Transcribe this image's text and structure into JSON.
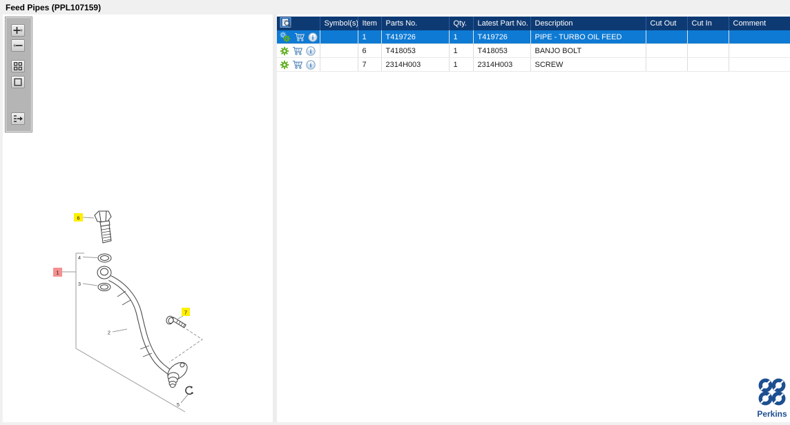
{
  "page": {
    "title": "Feed Pipes (PPL107159)"
  },
  "toolbar": {
    "buttons": [
      {
        "name": "zoom-in"
      },
      {
        "name": "zoom-out"
      },
      {
        "name": "fit-all"
      },
      {
        "name": "full-view"
      },
      {
        "name": "toggle-panel"
      }
    ]
  },
  "diagram": {
    "callouts": [
      {
        "label": "6",
        "highlight": "yellow"
      },
      {
        "label": "4",
        "highlight": "none"
      },
      {
        "label": "1",
        "highlight": "red"
      },
      {
        "label": "3",
        "highlight": "none"
      },
      {
        "label": "2",
        "highlight": "none"
      },
      {
        "label": "7",
        "highlight": "yellow"
      },
      {
        "label": "5",
        "highlight": "none"
      }
    ],
    "highlight_colors": {
      "yellow": "#ffef00",
      "red": "#f49090"
    }
  },
  "table": {
    "columns": [
      "",
      "Symbol(s)",
      "Item",
      "Parts No.",
      "Qty.",
      "Latest Part No.",
      "Description",
      "Cut Out",
      "Cut In",
      "Comment"
    ],
    "rows": [
      {
        "symbols": "",
        "item": "1",
        "parts_no": "T419726",
        "qty": "1",
        "latest_part_no": "T419726",
        "description": "PIPE - TURBO OIL FEED",
        "cut_out": "",
        "cut_in": "",
        "comment": "",
        "selected": true
      },
      {
        "symbols": "",
        "item": "6",
        "parts_no": "T418053",
        "qty": "1",
        "latest_part_no": "T418053",
        "description": "BANJO BOLT",
        "cut_out": "",
        "cut_in": "",
        "comment": "",
        "selected": false
      },
      {
        "symbols": "",
        "item": "7",
        "parts_no": "2314H003",
        "qty": "1",
        "latest_part_no": "2314H003",
        "description": "SCREW",
        "cut_out": "",
        "cut_in": "",
        "comment": "",
        "selected": false
      }
    ],
    "colors": {
      "header_bg": "#0e3a73",
      "selected_bg": "#0e7ad4",
      "gear_green": "#5fae1f",
      "cart_blue": "#4d82b8"
    }
  },
  "branding": {
    "logo_text": "Perkins",
    "logo_color": "#1d4f91"
  }
}
